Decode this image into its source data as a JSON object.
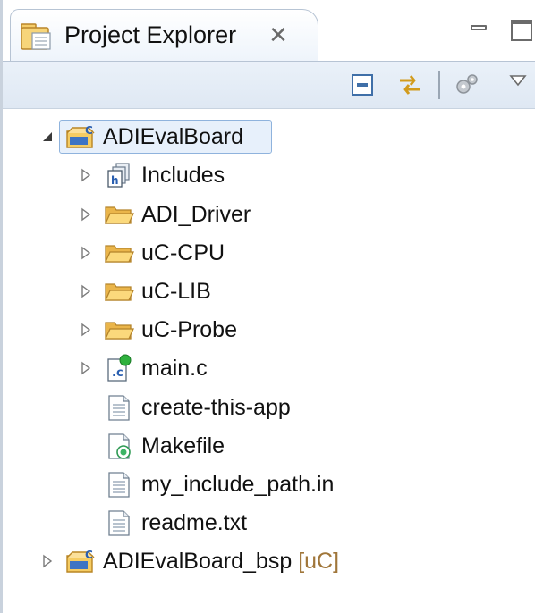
{
  "view": {
    "tab_title": "Project Explorer"
  },
  "tree": {
    "project": {
      "label": "ADIEvalBoard",
      "children": [
        {
          "label": "Includes",
          "kind": "includes"
        },
        {
          "label": "ADI_Driver",
          "kind": "folder"
        },
        {
          "label": "uC-CPU",
          "kind": "folder"
        },
        {
          "label": "uC-LIB",
          "kind": "folder"
        },
        {
          "label": "uC-Probe",
          "kind": "folder"
        },
        {
          "label": "main.c",
          "kind": "c-source"
        },
        {
          "label": "create-this-app",
          "kind": "file"
        },
        {
          "label": "Makefile",
          "kind": "makefile"
        },
        {
          "label": "my_include_path.in",
          "kind": "file"
        },
        {
          "label": "readme.txt",
          "kind": "file"
        }
      ]
    },
    "bsp_project": {
      "label": "ADIEvalBoard_bsp",
      "decoration": "[uC]"
    }
  },
  "colors": {
    "selection": "#e7f0fb",
    "folder": "#f2c45a",
    "decoration": "#a0763a"
  }
}
